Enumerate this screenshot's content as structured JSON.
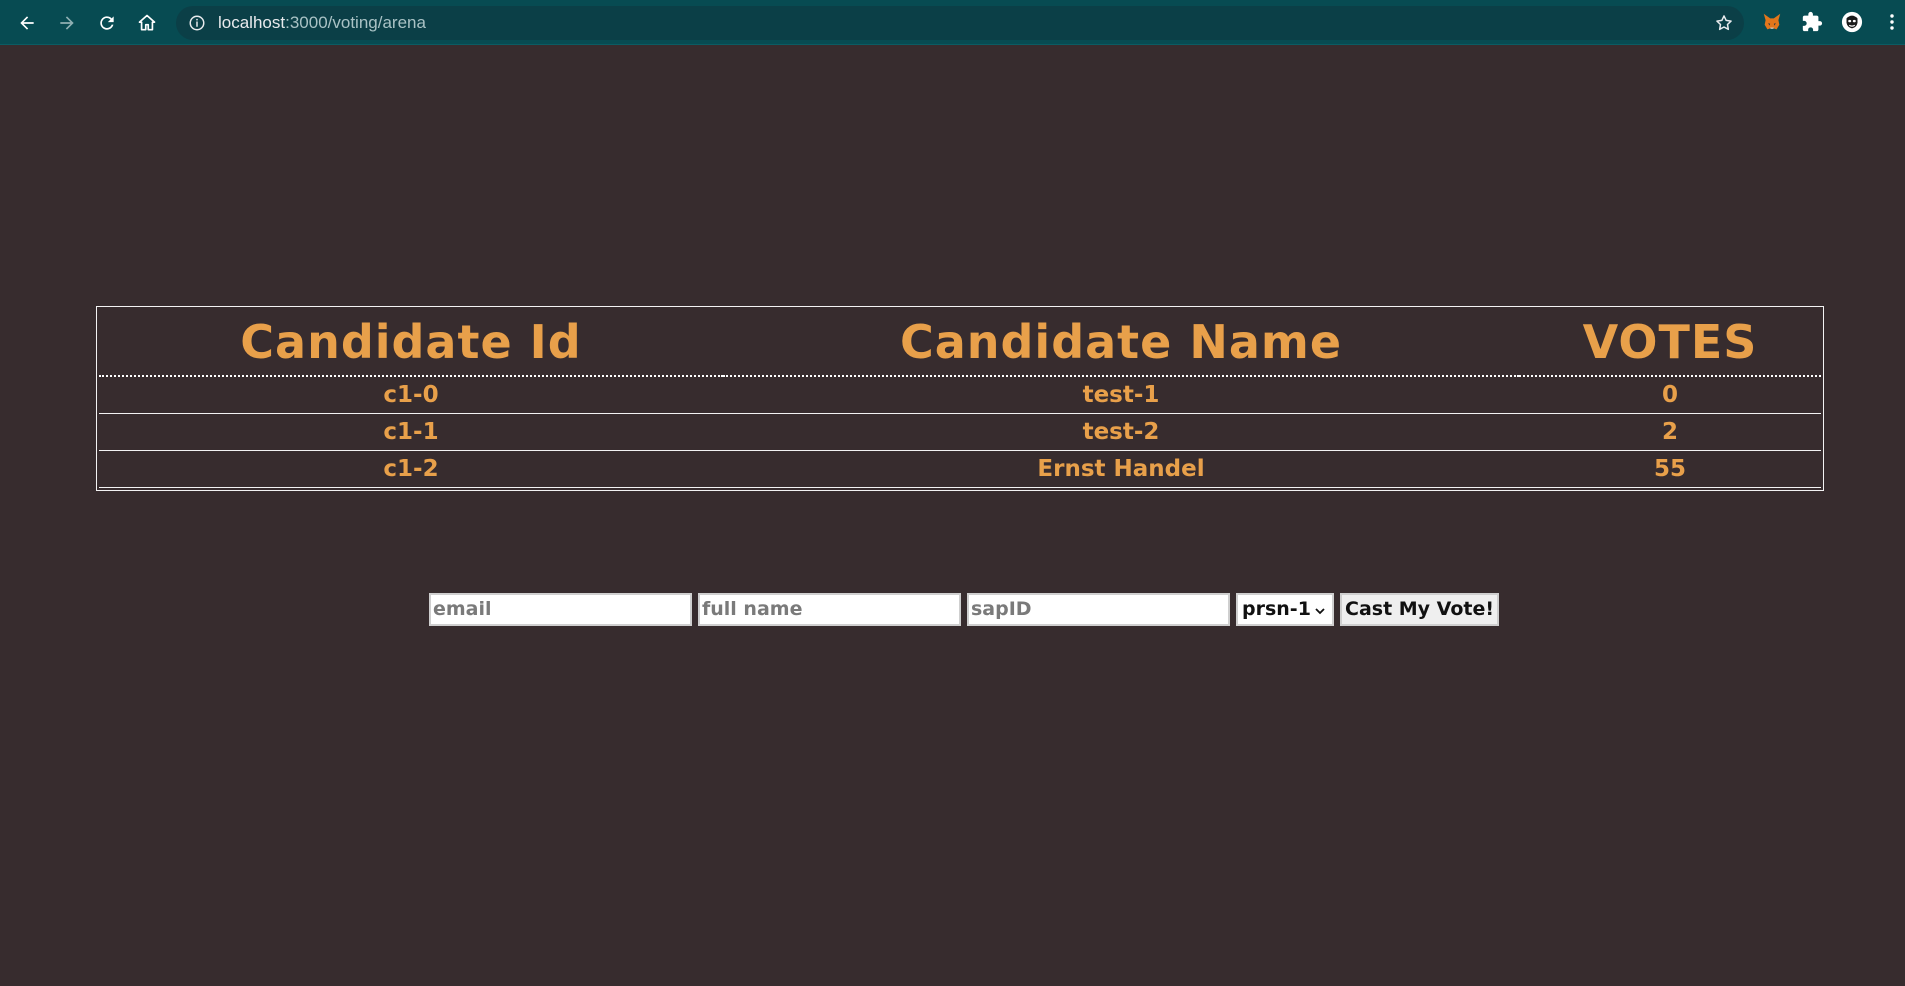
{
  "browser": {
    "url_host": "localhost",
    "url_path": ":3000/voting/arena"
  },
  "table": {
    "headers": [
      "Candidate Id",
      "Candidate Name",
      "VOTES"
    ],
    "rows": [
      [
        "c1-0",
        "test-1",
        "0"
      ],
      [
        "c1-1",
        "test-2",
        "2"
      ],
      [
        "c1-2",
        "Ernst Handel",
        "55"
      ]
    ]
  },
  "form": {
    "email_placeholder": "email",
    "name_placeholder": "full name",
    "sapid_placeholder": "sapID",
    "candidate_selected": "prsn-1",
    "submit_label": "Cast My Vote!"
  },
  "colors": {
    "background": "#372c2e",
    "accent": "#e8a04a",
    "toolbar": "#074b52"
  }
}
